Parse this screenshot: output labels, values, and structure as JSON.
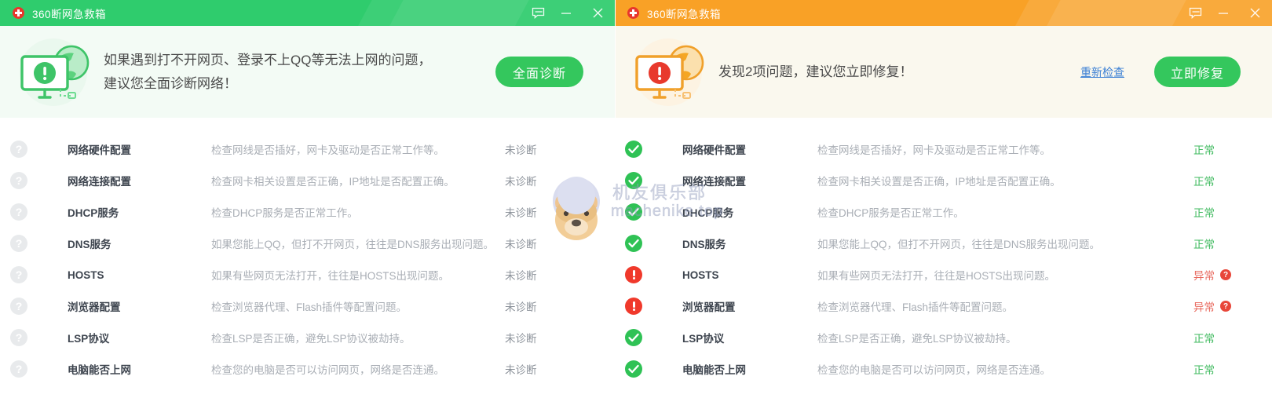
{
  "colors": {
    "green_title": "#2fcc6d",
    "orange_title": "#f9a126",
    "button_green": "#34c75d",
    "ok_green": "#3eba5e",
    "abnormal_red": "#e8675c",
    "link_blue": "#3b7fd4",
    "logo_red": "#e8362c",
    "muted_gray": "#a9aeb5"
  },
  "left_window": {
    "titlebar": {
      "logo_icon": "first-aid-cross-icon",
      "title": "360断网急救箱",
      "controls": [
        {
          "icon": "feedback-icon",
          "name": "feedback-button"
        },
        {
          "icon": "minimize-icon",
          "name": "minimize-button"
        },
        {
          "icon": "close-icon",
          "name": "close-button"
        }
      ]
    },
    "hero": {
      "art_icon": "monitor-warning-globe-green-icon",
      "line1": "如果遇到打不开网页、登录不上QQ等无法上网的问题，",
      "line2": "建议您全面诊断网络！",
      "primary_button": "全面诊断"
    },
    "rows": [
      {
        "status": "unknown",
        "status_icon": "question-circle-icon",
        "name": "网络硬件配置",
        "desc": "检查网线是否插好，网卡及驱动是否正常工作等。",
        "result": "未诊断",
        "result_state": "pending"
      },
      {
        "status": "unknown",
        "status_icon": "question-circle-icon",
        "name": "网络连接配置",
        "desc": "检查网卡相关设置是否正确，IP地址是否配置正确。",
        "result": "未诊断",
        "result_state": "pending"
      },
      {
        "status": "unknown",
        "status_icon": "question-circle-icon",
        "name": "DHCP服务",
        "desc": "检查DHCP服务是否正常工作。",
        "result": "未诊断",
        "result_state": "pending"
      },
      {
        "status": "unknown",
        "status_icon": "question-circle-icon",
        "name": "DNS服务",
        "desc": "如果您能上QQ，但打不开网页，往往是DNS服务出现问题。",
        "result": "未诊断",
        "result_state": "pending"
      },
      {
        "status": "unknown",
        "status_icon": "question-circle-icon",
        "name": "HOSTS",
        "desc": "如果有些网页无法打开，往往是HOSTS出现问题。",
        "result": "未诊断",
        "result_state": "pending"
      },
      {
        "status": "unknown",
        "status_icon": "question-circle-icon",
        "name": "浏览器配置",
        "desc": "检查浏览器代理、Flash插件等配置问题。",
        "result": "未诊断",
        "result_state": "pending"
      },
      {
        "status": "unknown",
        "status_icon": "question-circle-icon",
        "name": "LSP协议",
        "desc": "检查LSP是否正确，避免LSP协议被劫持。",
        "result": "未诊断",
        "result_state": "pending"
      },
      {
        "status": "unknown",
        "status_icon": "question-circle-icon",
        "name": "电脑能否上网",
        "desc": "检查您的电脑是否可以访问网页，网络是否连通。",
        "result": "未诊断",
        "result_state": "pending"
      }
    ]
  },
  "right_window": {
    "titlebar": {
      "logo_icon": "first-aid-cross-icon",
      "title": "360断网急救箱",
      "controls": [
        {
          "icon": "feedback-icon",
          "name": "feedback-button"
        },
        {
          "icon": "minimize-icon",
          "name": "minimize-button"
        },
        {
          "icon": "close-icon",
          "name": "close-button"
        }
      ]
    },
    "hero": {
      "art_icon": "monitor-warning-globe-orange-icon",
      "line1": "发现2项问题，建议您立即修复！",
      "line2": "",
      "recheck_link": "重新检查",
      "primary_button": "立即修复"
    },
    "rows": [
      {
        "status": "good",
        "status_icon": "check-circle-icon",
        "name": "网络硬件配置",
        "desc": "检查网线是否插好，网卡及驱动是否正常工作等。",
        "result": "正常",
        "result_state": "ok",
        "help_icon": null
      },
      {
        "status": "good",
        "status_icon": "check-circle-icon",
        "name": "网络连接配置",
        "desc": "检查网卡相关设置是否正确，IP地址是否配置正确。",
        "result": "正常",
        "result_state": "ok",
        "help_icon": null
      },
      {
        "status": "good",
        "status_icon": "check-circle-icon",
        "name": "DHCP服务",
        "desc": "检查DHCP服务是否正常工作。",
        "result": "正常",
        "result_state": "ok",
        "help_icon": null
      },
      {
        "status": "good",
        "status_icon": "check-circle-icon",
        "name": "DNS服务",
        "desc": "如果您能上QQ，但打不开网页，往往是DNS服务出现问题。",
        "result": "正常",
        "result_state": "ok",
        "help_icon": null
      },
      {
        "status": "bad",
        "status_icon": "exclamation-circle-icon",
        "name": "HOSTS",
        "desc": "如果有些网页无法打开，往往是HOSTS出现问题。",
        "result": "异常",
        "result_state": "abnormal",
        "help_icon": "help-circle-icon"
      },
      {
        "status": "bad",
        "status_icon": "exclamation-circle-icon",
        "name": "浏览器配置",
        "desc": "检查浏览器代理、Flash插件等配置问题。",
        "result": "异常",
        "result_state": "abnormal",
        "help_icon": "help-circle-icon"
      },
      {
        "status": "good",
        "status_icon": "check-circle-icon",
        "name": "LSP协议",
        "desc": "检查LSP是否正确，避免LSP协议被劫持。",
        "result": "正常",
        "result_state": "ok",
        "help_icon": null
      },
      {
        "status": "good",
        "status_icon": "check-circle-icon",
        "name": "电脑能否上网",
        "desc": "检查您的电脑是否可以访问网页，网络是否连通。",
        "result": "正常",
        "result_state": "ok",
        "help_icon": null
      }
    ]
  },
  "watermark": {
    "line1": "机友俱乐部",
    "line2": "machenike.top",
    "avatar_icon": "dog-avatar-icon"
  }
}
